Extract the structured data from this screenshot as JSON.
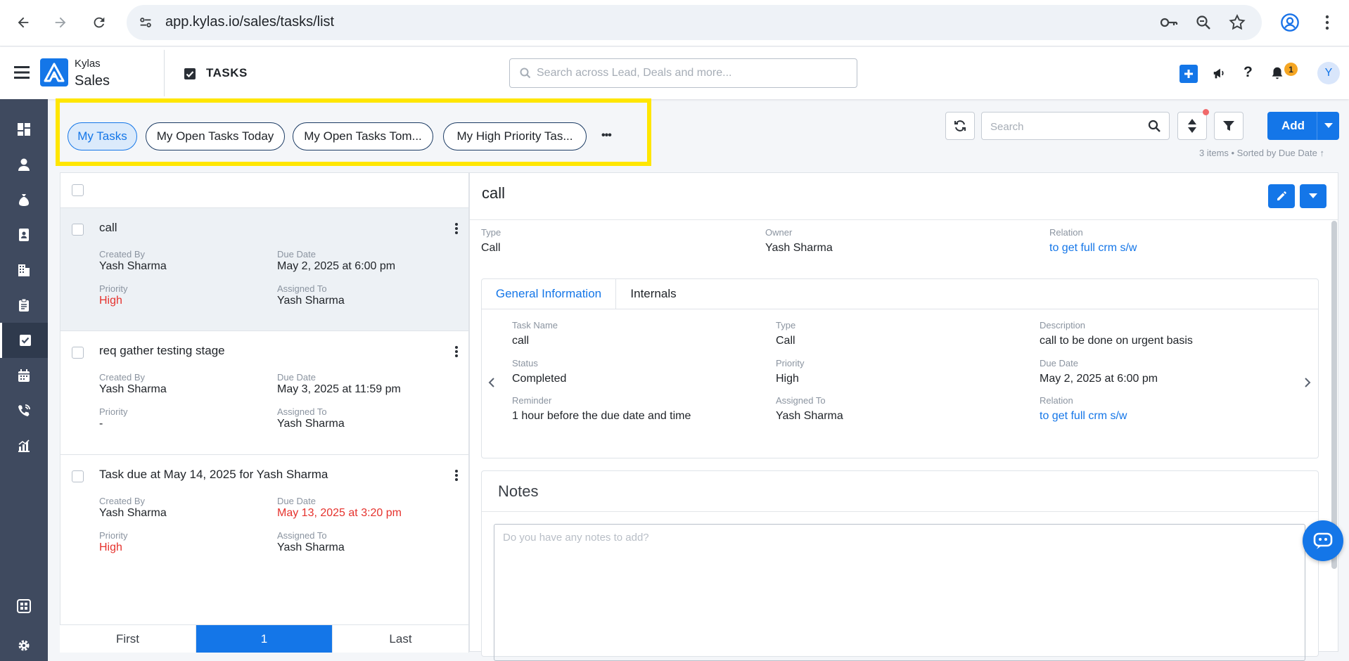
{
  "browser": {
    "url": "app.kylas.io/sales/tasks/list"
  },
  "header": {
    "brand_top": "Kylas",
    "brand_bottom": "Sales",
    "module_title": "TASKS",
    "search_placeholder": "Search across Lead, Deals and more...",
    "notification_count": "1",
    "avatar_initial": "Y"
  },
  "sidebar": {
    "items": [
      "dashboard",
      "leads",
      "deals",
      "contacts",
      "companies",
      "quotes",
      "tasks",
      "calendar",
      "calls",
      "reports"
    ],
    "bottom_items": [
      "apps",
      "settings"
    ],
    "active": "tasks"
  },
  "toolbar": {
    "views": [
      {
        "label": "My Tasks",
        "active": true
      },
      {
        "label": "My Open Tasks Today",
        "active": false
      },
      {
        "label": "My Open Tasks Tom...",
        "active": false
      },
      {
        "label": "My High Priority Tas...",
        "active": false
      }
    ],
    "more_label": "•••",
    "search_placeholder": "Search",
    "add_label": "Add",
    "items_info": "3 items • Sorted by  Due Date ↑"
  },
  "list": {
    "labels": {
      "created_by": "Created By",
      "due_date": "Due Date",
      "priority": "Priority",
      "assigned_to": "Assigned To"
    },
    "tasks": [
      {
        "title": "call",
        "created_by": "Yash Sharma",
        "due_date": "May 2, 2025 at 6:00 pm",
        "priority": "High",
        "assigned_to": "Yash Sharma"
      },
      {
        "title": "req gather testing stage",
        "created_by": "Yash Sharma",
        "due_date": "May 3, 2025 at 11:59 pm",
        "priority": "-",
        "assigned_to": "Yash Sharma"
      },
      {
        "title": "Task due at May 14, 2025 for Yash Sharma",
        "created_by": "Yash Sharma",
        "due_date": "May 13, 2025 at 3:20 pm",
        "priority": "High",
        "assigned_to": "Yash Sharma"
      }
    ],
    "pager": {
      "first": "First",
      "current": "1",
      "last": "Last"
    }
  },
  "detail": {
    "title": "call",
    "summary": {
      "type_label": "Type",
      "type": "Call",
      "owner_label": "Owner",
      "owner": "Yash Sharma",
      "relation_label": "Relation",
      "relation": "to get full crm s/w"
    },
    "tabs": [
      "General Information",
      "Internals"
    ],
    "fields": {
      "task_name_label": "Task Name",
      "task_name": "call",
      "type_label": "Type",
      "type": "Call",
      "description_label": "Description",
      "description": "call to be done on urgent basis",
      "status_label": "Status",
      "status": "Completed",
      "priority_label": "Priority",
      "priority": "High",
      "due_date_label": "Due Date",
      "due_date": "May 2, 2025 at 6:00 pm",
      "reminder_label": "Reminder",
      "reminder": "1 hour before the due date and time",
      "assigned_to_label": "Assigned To",
      "assigned_to": "Yash Sharma",
      "relation_label": "Relation",
      "relation": "to get full crm s/w"
    },
    "notes": {
      "title": "Notes",
      "placeholder": "Do you have any notes to add?"
    }
  },
  "colors": {
    "accent": "#1476e8",
    "danger": "#e5322d",
    "sidebar": "#3f4a5f",
    "highlight": "#ffe600",
    "badge": "#f5a623"
  }
}
